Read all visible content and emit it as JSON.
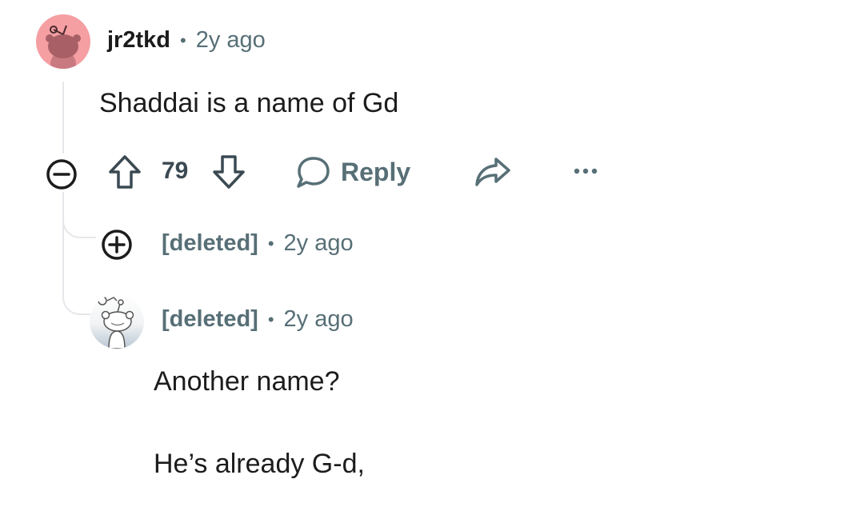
{
  "comments": [
    {
      "username": "jr2tkd",
      "separator": "•",
      "time": "2y ago",
      "body": "Shaddai is a name of Gd",
      "votes": "79",
      "reply_label": "Reply",
      "avatar_color": "#f59fa3"
    },
    {
      "username": "[deleted]",
      "separator": "•",
      "time": "2y ago",
      "collapsed": true
    },
    {
      "username": "[deleted]",
      "separator": "•",
      "time": "2y ago",
      "body_lines": [
        "Another name?",
        "He’s already G-d,"
      ]
    }
  ],
  "colors": {
    "text_primary": "#1c1c1c",
    "text_secondary": "#576f76",
    "thread_line": "#e5e7ea"
  },
  "icons": [
    "collapse-icon",
    "upvote-icon",
    "downvote-icon",
    "comment-icon",
    "share-icon",
    "more-icon",
    "expand-icon"
  ]
}
